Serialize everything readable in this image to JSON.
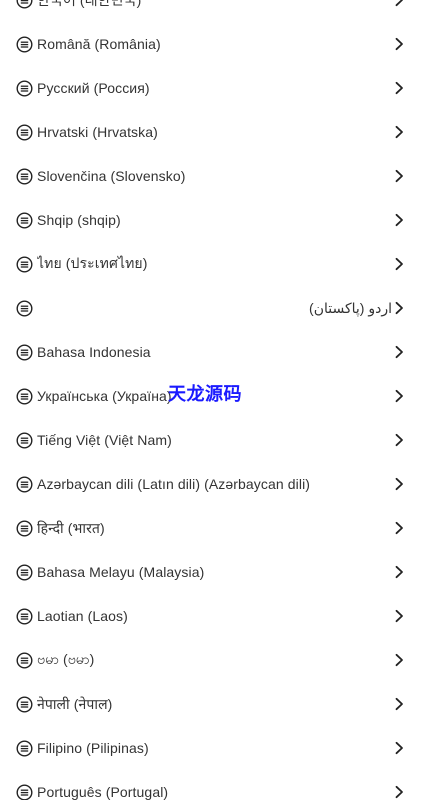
{
  "languages": [
    {
      "label": "한국어 (대한민국)"
    },
    {
      "label": "Română (România)"
    },
    {
      "label": "Русский (Россия)"
    },
    {
      "label": "Hrvatski (Hrvatska)"
    },
    {
      "label": "Slovenčina (Slovensko)"
    },
    {
      "label": "Shqip (shqip)"
    },
    {
      "label": "ไทย (ประเทศไทย)"
    },
    {
      "label": "اردو (پاکستان)"
    },
    {
      "label": "Bahasa Indonesia"
    },
    {
      "label": "Українська (Україна)"
    },
    {
      "label": "Tiếng Việt (Việt Nam)"
    },
    {
      "label": "Azərbaycan dili (Latın dili) (Azərbaycan dili)"
    },
    {
      "label": "हिन्दी (भारत)"
    },
    {
      "label": "Bahasa Melayu (Malaysia)"
    },
    {
      "label": "Laotian (Laos)"
    },
    {
      "label": "ဗမာ (ဗမာ)"
    },
    {
      "label": "नेपाली (नेपाल)"
    },
    {
      "label": "Filipino (Pilipinas)"
    },
    {
      "label": "Português (Portugal)"
    }
  ],
  "icons": {
    "row_icon": "language-list-icon",
    "row_action": "chevron-right-icon"
  },
  "colors": {
    "text": "#333333",
    "icon": "#222222",
    "background": "#ffffff",
    "watermark": "#1a1aff"
  },
  "watermark": "天龙源码"
}
